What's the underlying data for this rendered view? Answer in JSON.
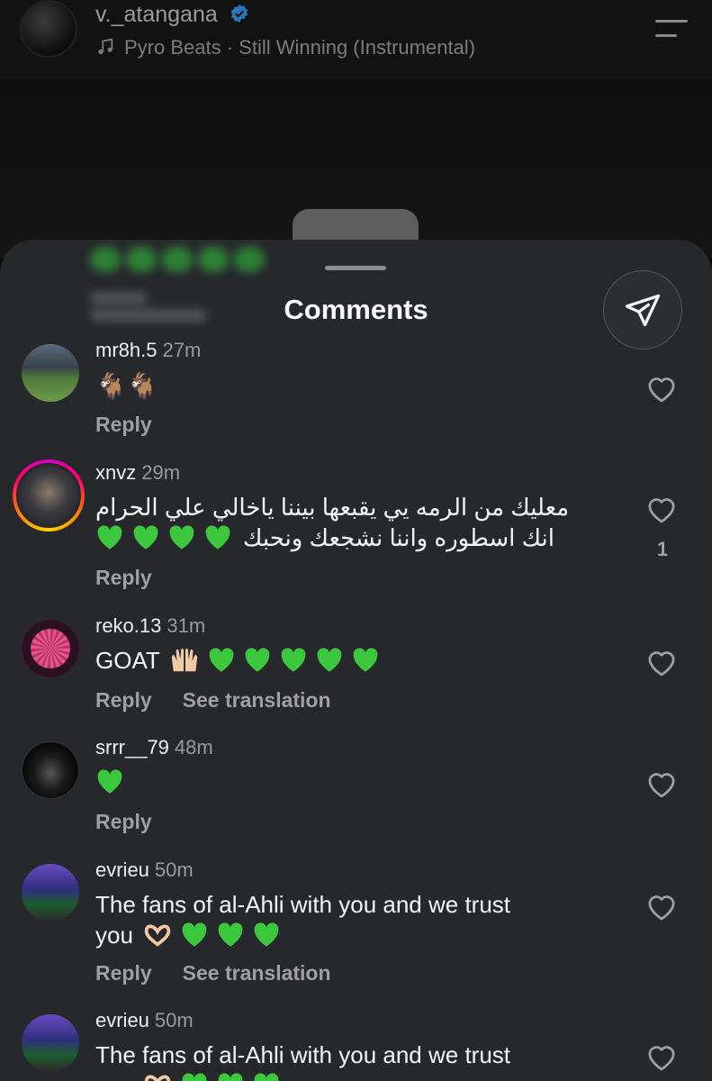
{
  "post": {
    "username": "v._atangana",
    "music": "Pyro Beats · Still Winning (Instrumental)"
  },
  "sheet": {
    "title": "Comments"
  },
  "comments": [
    {
      "username": "mr8h.5",
      "time": "27m",
      "text": "🐐🐐",
      "actions": [
        "Reply"
      ]
    },
    {
      "username": "xnvz",
      "time": "29m",
      "text_line1": "معليك من الرمه يي يقبعها بيننا ياخالي علي الحرام",
      "text_line2": "انك اسطوره واننا نشجعك ونحبك",
      "likes": "1",
      "actions": [
        "Reply"
      ]
    },
    {
      "username": "reko.13",
      "time": "31m",
      "text": "GOAT",
      "actions": [
        "Reply",
        "See translation"
      ]
    },
    {
      "username": "srrr__79",
      "time": "48m",
      "actions": [
        "Reply"
      ]
    },
    {
      "username": "evrieu",
      "time": "50m",
      "text_line1": "The fans of al-Ahli with you and we trust",
      "text_line2": "you",
      "actions": [
        "Reply",
        "See translation"
      ]
    },
    {
      "username": "evrieu",
      "time": "50m",
      "text_line1": "The fans of al-Ahli with you and we trust",
      "text_line2": "you"
    }
  ],
  "colors": {
    "sheet_bg": "#26282c",
    "accent_green": "#3cc83c",
    "muted_text": "#a0a0a0"
  }
}
